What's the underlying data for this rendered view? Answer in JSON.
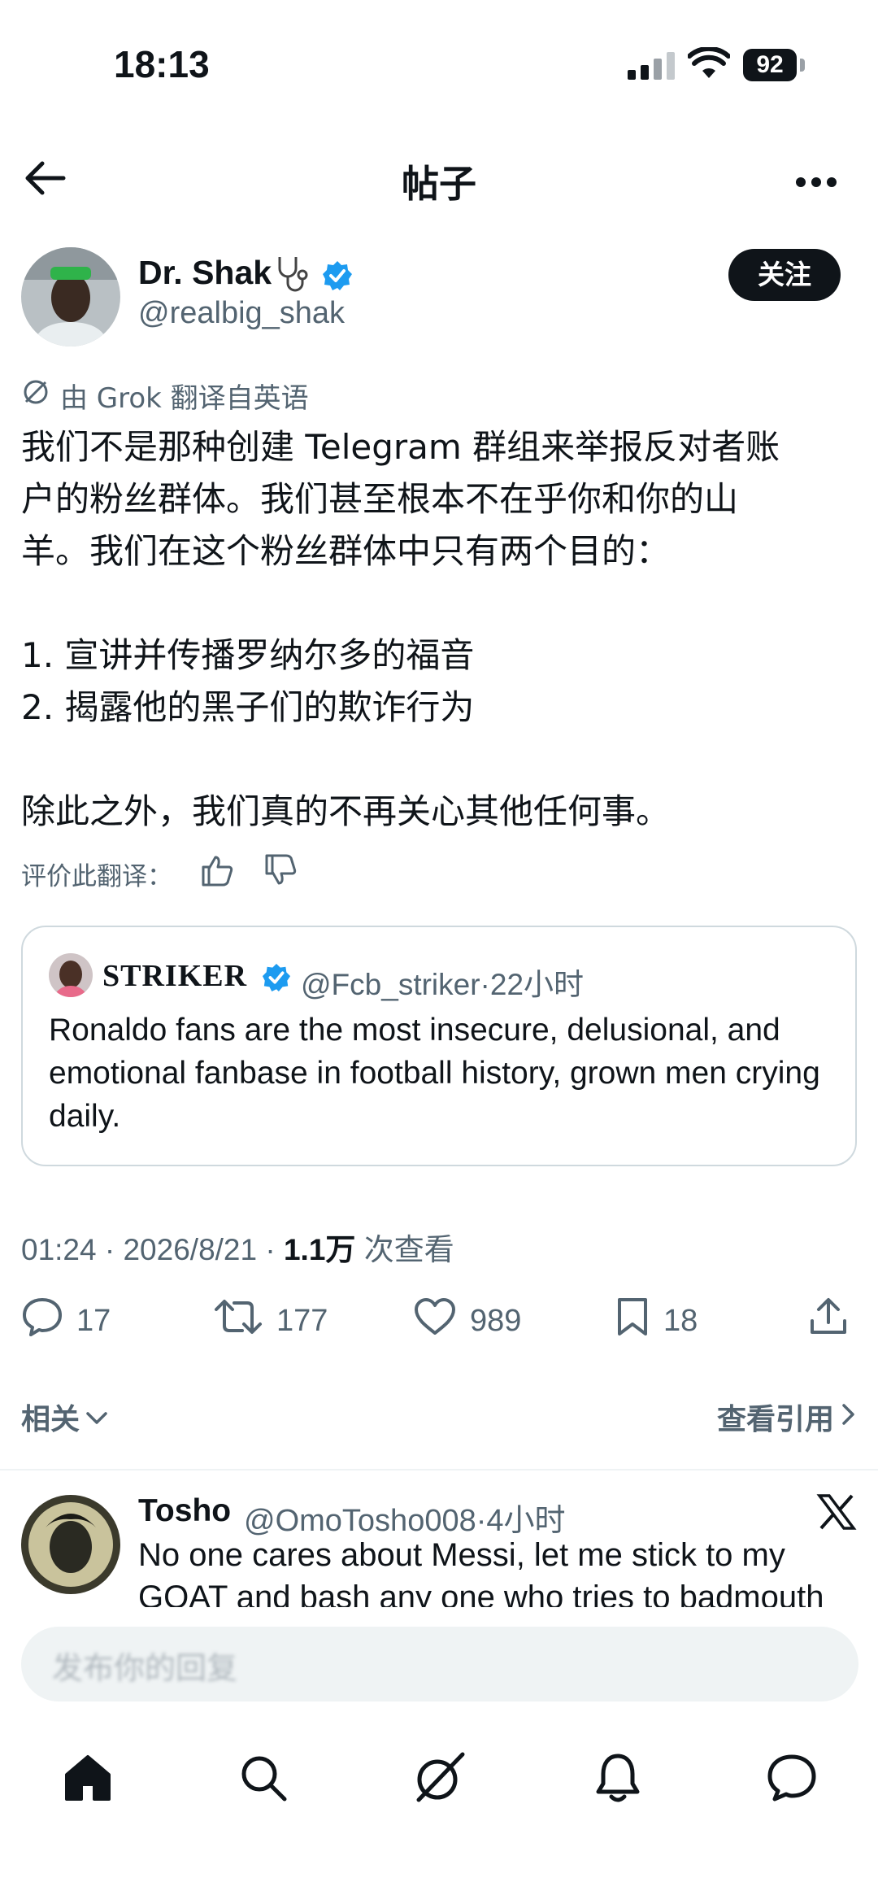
{
  "status_bar": {
    "time": "18:13",
    "battery": "92"
  },
  "header": {
    "title": "帖子"
  },
  "post": {
    "author_name": "Dr. Shak",
    "author_handle": "@realbig_shak",
    "follow_label": "关注",
    "translated_note": "由 Grok 翻译自英语",
    "body": "我们不是那种创建 Telegram 群组来举报反对者账\n户的粉丝群体。我们甚至根本不在乎你和你的山\n羊。我们在这个粉丝群体中只有两个目的：\n\n1. 宣讲并传播罗纳尔多的福音\n2. 揭露他的黑子们的欺诈行为\n\n除此之外，我们真的不再关心其他任何事。",
    "rate_label": "评价此翻译：",
    "time": "01:24",
    "date": "2026/8/21",
    "views_count": "1.1万",
    "views_label": "次查看",
    "stats": {
      "replies": "17",
      "reposts": "177",
      "likes": "989",
      "bookmarks": "18"
    }
  },
  "quote": {
    "name": "STRIKER",
    "handle": "@Fcb_striker",
    "age": "22小时",
    "text": "Ronaldo fans are the most insecure, delusional, and emotional fanbase in football history, grown men crying daily."
  },
  "related": {
    "label": "相关",
    "view_quotes": "查看引用"
  },
  "reply": {
    "name": "Tosho",
    "handle": "@OmoTosho008",
    "age": "4小时",
    "text": "No one cares about Messi, let me stick to my GOAT and bash any one who tries to badmouth"
  },
  "composer": {
    "placeholder": "发布你的回复"
  },
  "colors": {
    "accent": "#1d9bf0",
    "text": "#0f1419",
    "muted": "#536471"
  },
  "icons": [
    "back-arrow-icon",
    "more-icon",
    "verified-icon",
    "grok-icon",
    "thumbs-up-icon",
    "thumbs-down-icon",
    "reply-icon",
    "repost-icon",
    "like-icon",
    "bookmark-icon",
    "share-icon",
    "chevron-down-icon",
    "chevron-right-icon",
    "x-logo-icon",
    "home-icon",
    "search-icon",
    "grok-tab-icon",
    "notifications-icon",
    "messages-icon"
  ]
}
